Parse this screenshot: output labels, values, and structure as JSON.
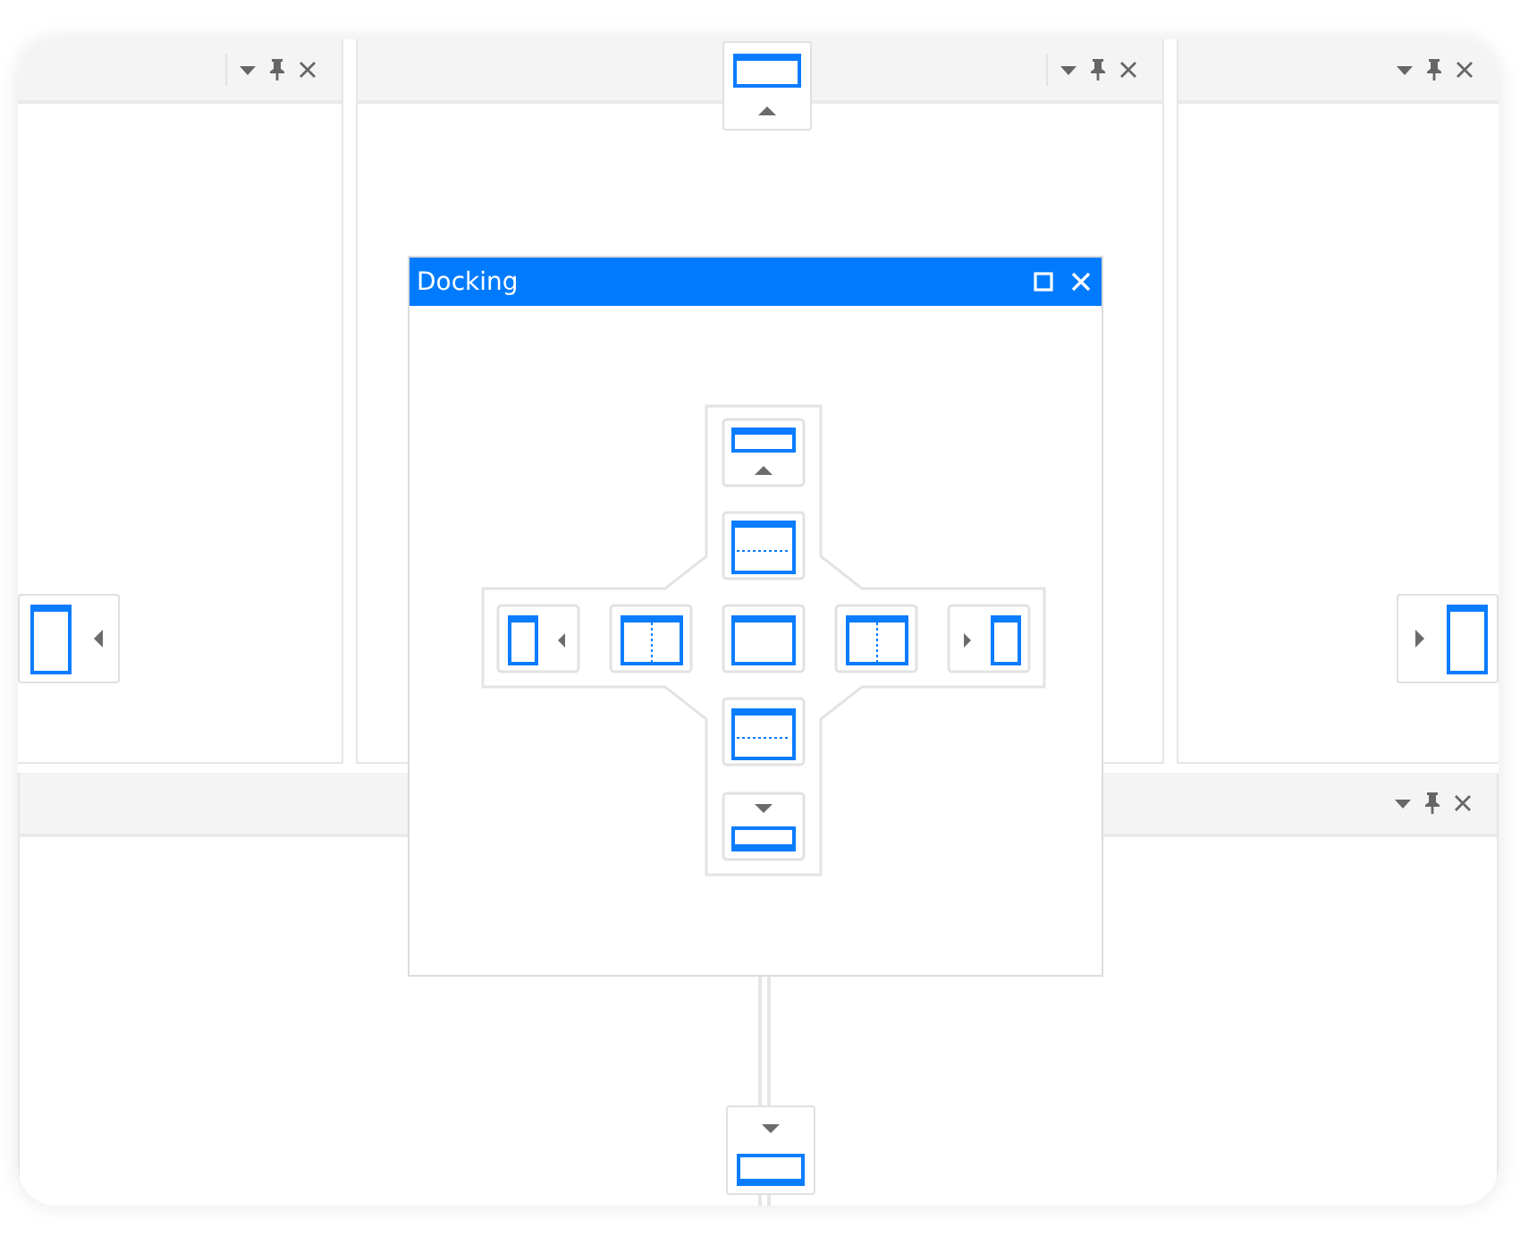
{
  "floating_window": {
    "title": "Docking"
  }
}
